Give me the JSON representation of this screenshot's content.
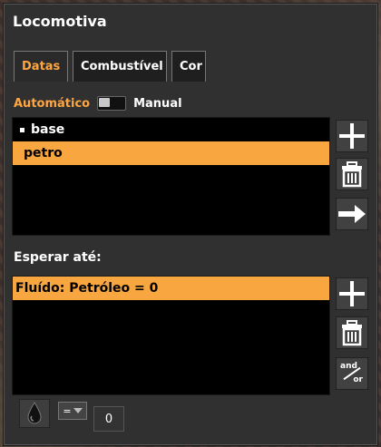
{
  "window": {
    "title": "Locomotiva"
  },
  "tabs": [
    {
      "label": "Datas",
      "active": true
    },
    {
      "label": "Combustível",
      "active": false
    },
    {
      "label": "Cor",
      "active": false
    }
  ],
  "mode_switch": {
    "left": "Automático",
    "right": "Manual",
    "state": "left"
  },
  "stations": {
    "items": [
      {
        "label": "base",
        "bullet": true,
        "selected": false
      },
      {
        "label": "petro",
        "bullet": false,
        "selected": true
      }
    ]
  },
  "wait": {
    "label": "Esperar até:",
    "conditions": [
      {
        "label": "Fluído: Petróleo = 0",
        "selected": true
      }
    ]
  },
  "controls": {
    "comparator": "=",
    "value": "0",
    "and_or": {
      "top": "and",
      "bottom": "or"
    }
  },
  "icons": {
    "add": "plus-icon",
    "delete": "trash-icon",
    "go": "arrow-right-icon",
    "fluid": "oil-drop-icon"
  },
  "colors": {
    "accent": "#ffa640",
    "selected": "#f7a640",
    "panel": "#313031"
  }
}
